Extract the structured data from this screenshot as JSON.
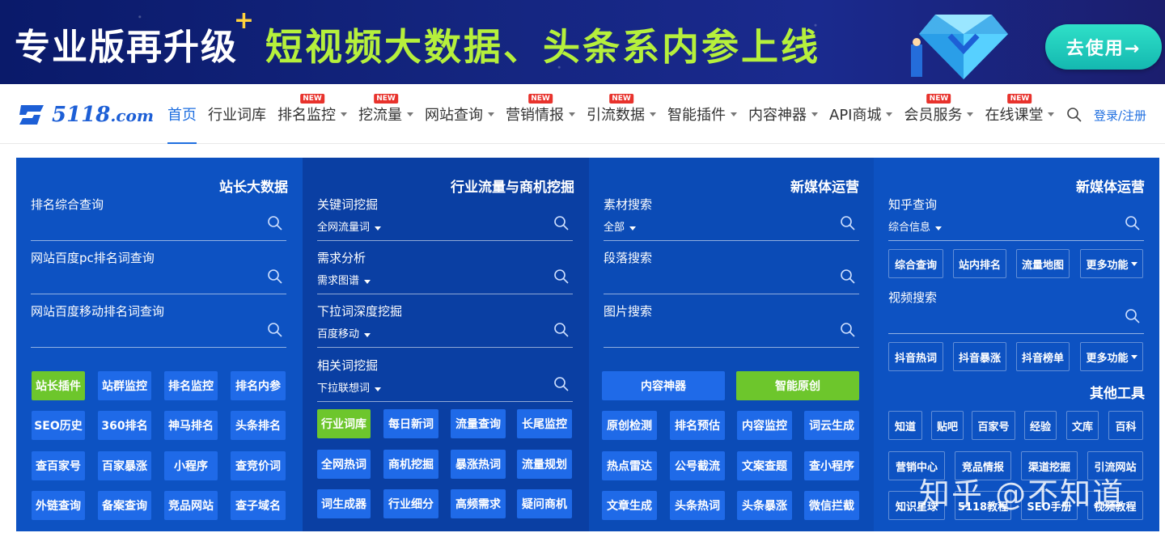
{
  "banner": {
    "left_text": "专业版再升级",
    "plus": "+",
    "right_text": "短视频大数据、头条系内参上线",
    "cta": "去使用→"
  },
  "nav": {
    "logo": "5118",
    "logo_suffix": ".com",
    "items": [
      {
        "label": "首页",
        "active": true,
        "caret": false,
        "new": false
      },
      {
        "label": "行业词库",
        "caret": false,
        "new": false
      },
      {
        "label": "排名监控",
        "caret": true,
        "new": true
      },
      {
        "label": "挖流量",
        "caret": true,
        "new": true
      },
      {
        "label": "网站查询",
        "caret": true,
        "new": false
      },
      {
        "label": "营销情报",
        "caret": true,
        "new": true
      },
      {
        "label": "引流数据",
        "caret": true,
        "new": true
      },
      {
        "label": "智能插件",
        "caret": true,
        "new": false
      },
      {
        "label": "内容神器",
        "caret": true,
        "new": false
      },
      {
        "label": "API商城",
        "caret": true,
        "new": false
      },
      {
        "label": "会员服务",
        "caret": true,
        "new": true
      },
      {
        "label": "在线课堂",
        "caret": true,
        "new": true
      }
    ],
    "new_badge": "NEW",
    "login": "登录/注册"
  },
  "col_a": {
    "title": "站长大数据",
    "fields": [
      {
        "label": "排名综合查询"
      },
      {
        "label": "网站百度pc排名词查询"
      },
      {
        "label": "网站百度移动排名词查询"
      }
    ],
    "buttons": [
      [
        "站长插件",
        "站群监控",
        "排名监控",
        "排名内参"
      ],
      [
        "SEO历史",
        "360排名",
        "神马排名",
        "头条排名"
      ],
      [
        "查百家号",
        "百家暴涨",
        "小程序",
        "查竞价词"
      ],
      [
        "外链查询",
        "备案查询",
        "竞品网站",
        "查子域名"
      ]
    ]
  },
  "col_b": {
    "title": "行业流量与商机挖掘",
    "fields": [
      {
        "label": "关键词挖掘",
        "sub": "全网流量词"
      },
      {
        "label": "需求分析",
        "sub": "需求图谱"
      },
      {
        "label": "下拉词深度挖掘",
        "sub": "百度移动"
      },
      {
        "label": "相关词挖掘",
        "sub": "下拉联想词"
      }
    ],
    "buttons": [
      [
        "行业词库",
        "每日新词",
        "流量查询",
        "长尾监控"
      ],
      [
        "全网热词",
        "商机挖掘",
        "暴涨热词",
        "流量规划"
      ],
      [
        "词生成器",
        "行业细分",
        "高频需求",
        "疑问商机"
      ]
    ]
  },
  "col_c": {
    "title": "新媒体运营",
    "fields": [
      {
        "label": "素材搜索",
        "sub": "全部"
      },
      {
        "label": "段落搜索"
      },
      {
        "label": "图片搜索"
      }
    ],
    "wide_buttons": [
      "内容神器",
      "智能原创"
    ],
    "buttons": [
      [
        "原创检测",
        "排名预估",
        "内容监控",
        "词云生成"
      ],
      [
        "热点雷达",
        "公号截流",
        "文案查题",
        "查小程序"
      ],
      [
        "文章生成",
        "头条热词",
        "头条暴涨",
        "微信拦截"
      ]
    ]
  },
  "col_d": {
    "title": "新媒体运营",
    "zhihu": {
      "label": "知乎查询",
      "sub": "综合信息"
    },
    "zhihu_buttons": [
      "综合查询",
      "站内排名",
      "流量地图",
      "更多功能"
    ],
    "video": {
      "label": "视频搜索"
    },
    "video_buttons": [
      "抖音热词",
      "抖音暴涨",
      "抖音榜单",
      "更多功能"
    ],
    "other_title": "其他工具",
    "other_row1": [
      "知道",
      "贴吧",
      "百家号",
      "经验",
      "文库",
      "百科"
    ],
    "other_row2": [
      "营销中心",
      "竞品情报",
      "渠道挖掘",
      "引流网站"
    ],
    "other_row3": [
      "知识星球",
      "5118教程",
      "SEO手册",
      "视频教程"
    ]
  },
  "watermark": "知乎 @不知道"
}
